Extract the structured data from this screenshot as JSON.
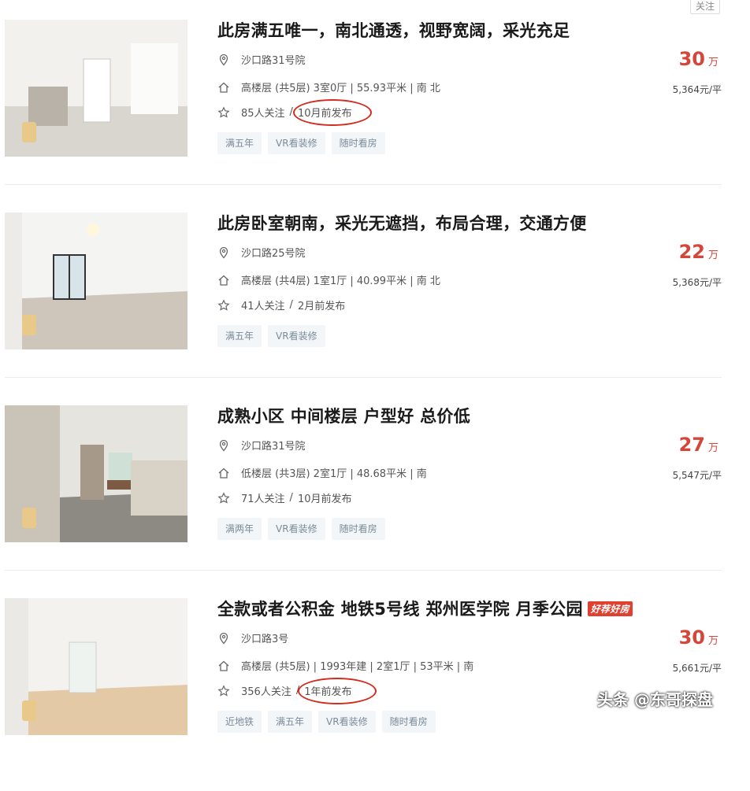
{
  "header": {
    "follow_label": "关注"
  },
  "listings": [
    {
      "title": "此房满五唯一，南北通透，视野宽阔，采光充足",
      "address": "沙口路31号院",
      "info": "高楼层 (共5层) 3室0厅 | 55.93平米 | 南 北",
      "follow_count": "85人关注",
      "sep": "/",
      "published": "10月前发布",
      "tags": [
        "满五年",
        "VR看装修",
        "随时看房"
      ],
      "price": "30",
      "price_unit": "万",
      "unit_price": "5,364元/平",
      "badge": ""
    },
    {
      "title": "此房卧室朝南，采光无遮挡，布局合理，交通方便",
      "address": "沙口路25号院",
      "info": "高楼层 (共4层) 1室1厅 | 40.99平米 | 南 北",
      "follow_count": "41人关注",
      "sep": "/",
      "published": "2月前发布",
      "tags": [
        "满五年",
        "VR看装修"
      ],
      "price": "22",
      "price_unit": "万",
      "unit_price": "5,368元/平",
      "badge": ""
    },
    {
      "title": "成熟小区 中间楼层 户型好 总价低",
      "address": "沙口路31号院",
      "info": "低楼层 (共3层) 2室1厅 | 48.68平米 | 南",
      "follow_count": "71人关注",
      "sep": "/",
      "published": "10月前发布",
      "tags": [
        "满两年",
        "VR看装修",
        "随时看房"
      ],
      "price": "27",
      "price_unit": "万",
      "unit_price": "5,547元/平",
      "badge": ""
    },
    {
      "title": "全款或者公积金 地铁5号线 郑州医学院 月季公园",
      "address": "沙口路3号",
      "info": "高楼层 (共5层) | 1993年建 | 2室1厅 | 53平米 | 南",
      "follow_count": "356人关注",
      "sep": "/",
      "published": "1年前发布",
      "tags": [
        "近地铁",
        "满五年",
        "VR看装修",
        "随时看房"
      ],
      "price": "30",
      "price_unit": "万",
      "unit_price": "5,661元/平",
      "badge": "好荐好房"
    }
  ],
  "watermark": "头条 @东哥探盘",
  "colors": {
    "price": "#d4463a",
    "tag_bg": "#f3f6f9",
    "highlight_circle": "#d42a1e"
  },
  "icons": {
    "address": "location-pin-icon",
    "info": "house-icon",
    "follow": "star-icon"
  }
}
